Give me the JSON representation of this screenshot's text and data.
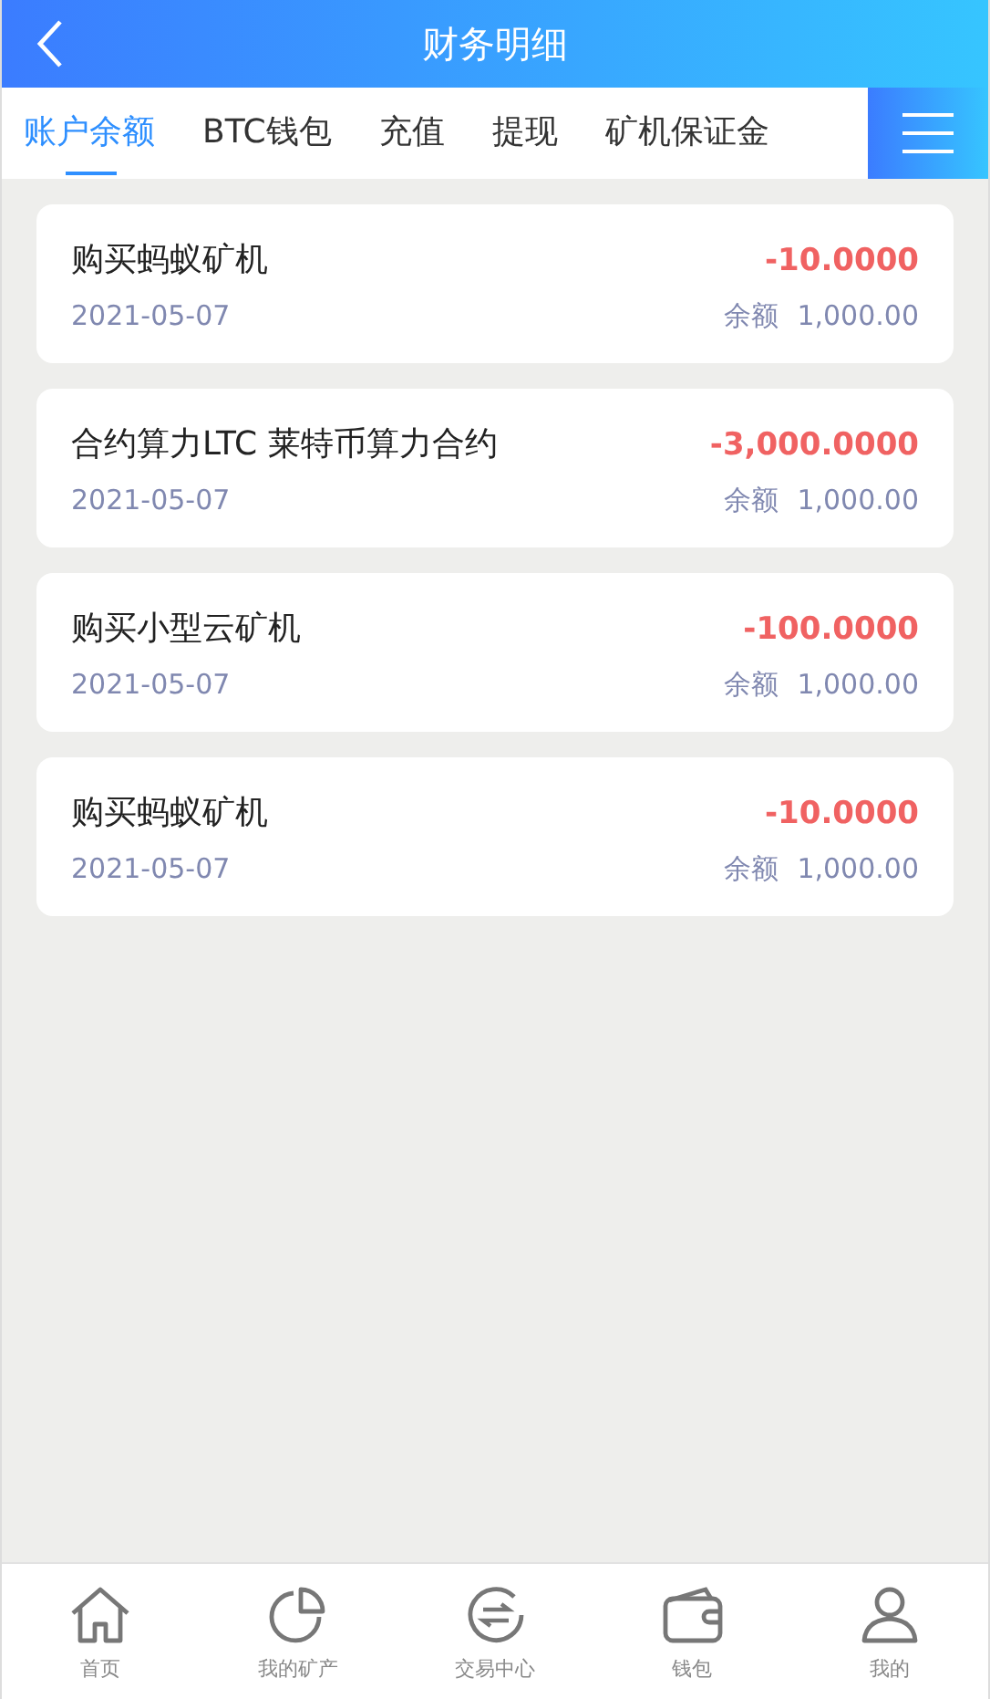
{
  "header": {
    "title": "财务明细"
  },
  "tabs": [
    {
      "label": "账户余额",
      "selected": true
    },
    {
      "label": "BTC钱包",
      "selected": false
    },
    {
      "label": "充值",
      "selected": false
    },
    {
      "label": "提现",
      "selected": false
    },
    {
      "label": "矿机保证金",
      "selected": false
    }
  ],
  "records": [
    {
      "title": "购买蚂蚁矿机",
      "date": "2021-05-07",
      "amount": "-10.0000",
      "balance_label": "余额",
      "balance": "1,000.00"
    },
    {
      "title": "合约算力LTC 莱特币算力合约",
      "date": "2021-05-07",
      "amount": "-3,000.0000",
      "balance_label": "余额",
      "balance": "1,000.00"
    },
    {
      "title": "购买小型云矿机",
      "date": "2021-05-07",
      "amount": "-100.0000",
      "balance_label": "余额",
      "balance": "1,000.00"
    },
    {
      "title": "购买蚂蚁矿机",
      "date": "2021-05-07",
      "amount": "-10.0000",
      "balance_label": "余额",
      "balance": "1,000.00"
    }
  ],
  "bottom_nav": [
    {
      "kind": "home",
      "label": "首页"
    },
    {
      "kind": "pie",
      "label": "我的矿产"
    },
    {
      "kind": "exchange",
      "label": "交易中心"
    },
    {
      "kind": "wallet",
      "label": "钱包"
    },
    {
      "kind": "user",
      "label": "我的"
    }
  ]
}
